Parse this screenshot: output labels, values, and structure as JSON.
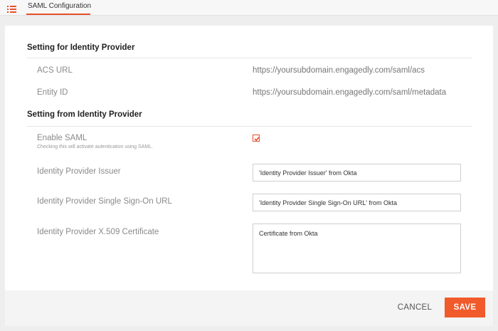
{
  "header": {
    "menu_icon": "list-menu-icon",
    "tab_label": "SAML Configuration",
    "accent_color": "#e8502b"
  },
  "section_for_idp": {
    "title": "Setting for Identity Provider",
    "rows": [
      {
        "label": "ACS URL",
        "value": "https://yoursubdomain.engagedly.com/saml/acs"
      },
      {
        "label": "Entity ID",
        "value": "https://yoursubdomain.engagedly.com/saml/metadata"
      }
    ]
  },
  "section_from_idp": {
    "title": "Setting from Identity Provider",
    "enable_saml": {
      "label": "Enable SAML",
      "hint": "Checking this will activate autentication using SAML.",
      "checked": true,
      "icon": "checkmark-icon"
    },
    "issuer": {
      "label": "Identity Provider Issuer",
      "value": "'Identity Provider Issuer'  from Okta"
    },
    "sso_url": {
      "label": "Identity Provider Single Sign-On URL",
      "value": "'Identity Provider Single Sign-On URL' from Okta"
    },
    "certificate": {
      "label": "Identity Provider X.509 Certificate",
      "value": "Certificate from Okta"
    }
  },
  "footer": {
    "cancel_label": "CANCEL",
    "save_label": "SAVE",
    "save_color": "#f15a2b"
  }
}
